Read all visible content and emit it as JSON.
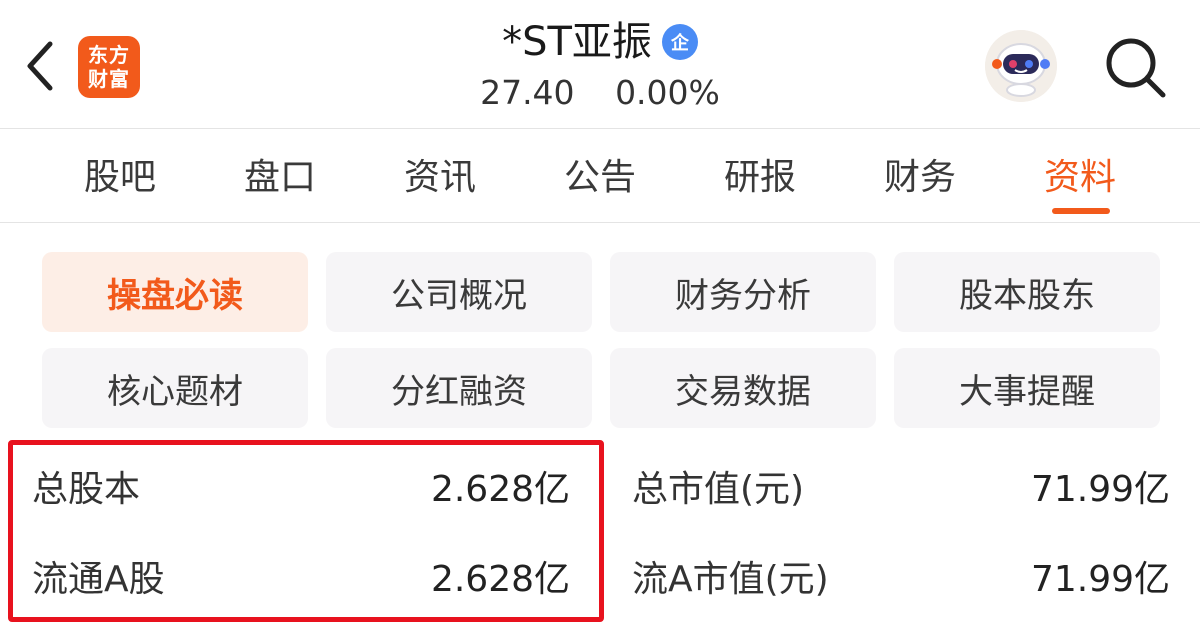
{
  "header": {
    "logo_line1": "东方",
    "logo_line2": "财富",
    "stock_name": "*ST亚振",
    "cert_badge": "企",
    "price": "27.40",
    "change_pct": "0.00%"
  },
  "tabs": [
    {
      "label": "股吧",
      "active": false
    },
    {
      "label": "盘口",
      "active": false
    },
    {
      "label": "资讯",
      "active": false
    },
    {
      "label": "公告",
      "active": false
    },
    {
      "label": "研报",
      "active": false
    },
    {
      "label": "财务",
      "active": false
    },
    {
      "label": "资料",
      "active": true
    }
  ],
  "sections": [
    {
      "label": "操盘必读",
      "active": true
    },
    {
      "label": "公司概况",
      "active": false
    },
    {
      "label": "财务分析",
      "active": false
    },
    {
      "label": "股本股东",
      "active": false
    },
    {
      "label": "核心题材",
      "active": false
    },
    {
      "label": "分红融资",
      "active": false
    },
    {
      "label": "交易数据",
      "active": false
    },
    {
      "label": "大事提醒",
      "active": false
    }
  ],
  "stats": [
    {
      "label": "总股本",
      "value": "2.628亿"
    },
    {
      "label": "总市值(元)",
      "value": "71.99亿"
    },
    {
      "label": "流通A股",
      "value": "2.628亿"
    },
    {
      "label": "流A市值(元)",
      "value": "71.99亿"
    }
  ],
  "colors": {
    "accent": "#f25a1b",
    "highlight_border": "#e8121e",
    "button_bg": "#f6f5f7",
    "active_button_bg": "#fdeee6",
    "cert_badge": "#4a8cf5"
  },
  "icons": {
    "back": "chevron-left-icon",
    "search": "search-icon",
    "avatar": "robot-avatar-icon"
  }
}
